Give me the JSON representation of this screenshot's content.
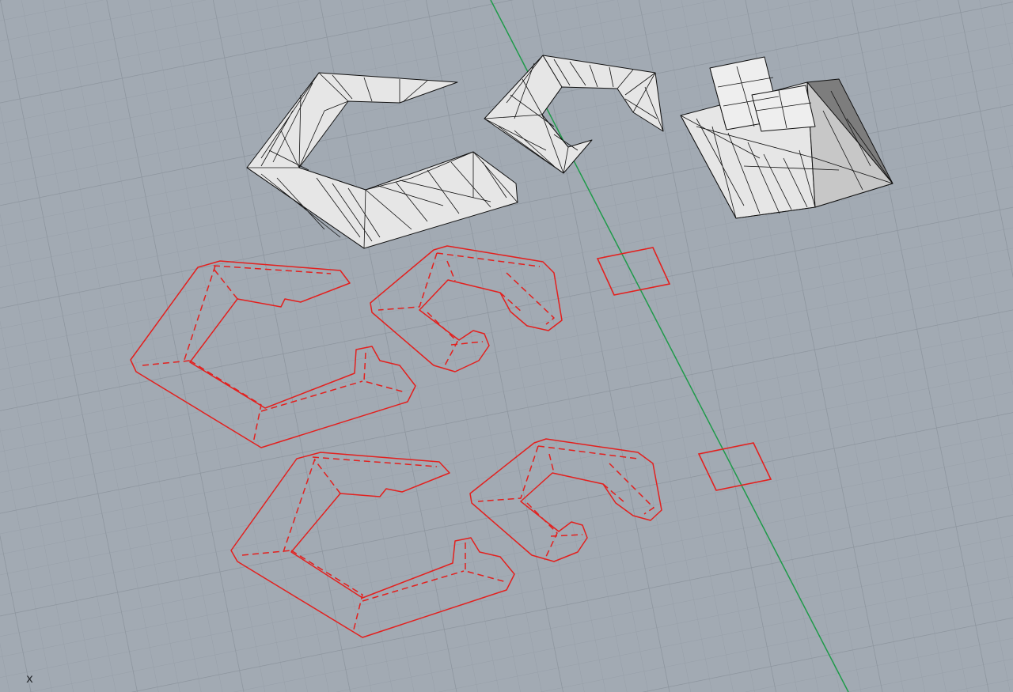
{
  "viewport": {
    "axis_label": "x",
    "colors": {
      "background": "#a2aab3",
      "grid_minor": "#98a0a9",
      "grid_major": "#8b939c",
      "y_axis": "#1f9a4a",
      "curves": "#e3201e",
      "mesh_fill": "#e6e6e6",
      "mesh_edge": "#111111"
    }
  },
  "objects": {
    "meshes": [
      "mesh-c-large",
      "mesh-c-small",
      "mesh-square-frustum"
    ],
    "curves": [
      "curve-c-large-row1",
      "curve-c-small-row1",
      "curve-square-row1",
      "curve-c-large-row2",
      "curve-c-small-row2",
      "curve-square-row2"
    ]
  }
}
